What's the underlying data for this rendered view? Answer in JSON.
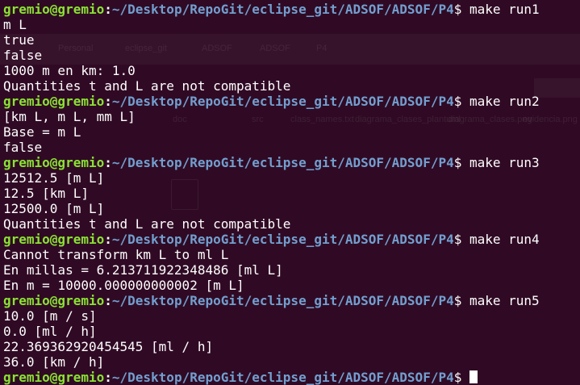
{
  "prompt": {
    "user_host": "gremio@gremio",
    "separator": ":",
    "path": "~/Desktop/RepoGit/eclipse_git/ADSOF/ADSOF/P4",
    "dollar": "$"
  },
  "commands": [
    {
      "command": " make run1",
      "output": [
        "m L",
        "true",
        "false",
        "1000 m en km: 1.0",
        "Quantities t and L are not compatible"
      ]
    },
    {
      "command": " make run2",
      "output": [
        "[km L, m L, mm L]",
        "Base = m L",
        "false"
      ]
    },
    {
      "command": " make run3",
      "output": [
        "12512.5 [m L]",
        "12.5 [km L]",
        "12500.0 [m L]",
        "Quantities t and L are not compatible"
      ]
    },
    {
      "command": " make run4",
      "output": [
        "Cannot transform km L to ml L",
        "En millas = 6.213711922348486 [ml L]",
        "En m = 10000.000000000002 [m L]"
      ]
    },
    {
      "command": " make run5",
      "output": [
        "10.0 [m / s]",
        "0.0 [ml / h]",
        "22.369362920454545 [ml / h]",
        "36.0 [km / h]"
      ]
    }
  ],
  "background_window": {
    "tabs": [
      "Personal",
      "eclipse_git",
      "ADSOF",
      "ADSOF",
      "P4"
    ],
    "files": [
      "doc",
      "src",
      "class_names.txt",
      "diagrama_clases_plantuml",
      "diagrama_clases.png",
      "evidencia.png"
    ]
  },
  "colors": {
    "background": "#300a24",
    "prompt_user": "#8ae234",
    "prompt_path": "#729fcf",
    "text": "#ffffff"
  }
}
